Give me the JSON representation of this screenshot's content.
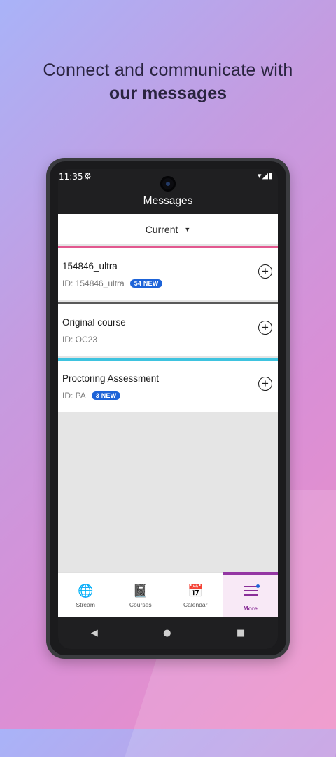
{
  "promo": {
    "line1": "Connect and communicate with",
    "line2": "our messages"
  },
  "status": {
    "time": "11:35",
    "gear_icon": "⚙",
    "icons": "▾◢▮"
  },
  "appbar": {
    "title": "Messages"
  },
  "filter": {
    "label": "Current",
    "caret": "▼"
  },
  "courses": [
    {
      "name": "154846_ultra",
      "id_text": "ID: 154846_ultra",
      "badge": "54 NEW",
      "color": "#e2588f"
    },
    {
      "name": "Original course",
      "id_text": "ID: OC23",
      "badge": "",
      "color": "#5a5a5a"
    },
    {
      "name": "Proctoring Assessment",
      "id_text": "ID: PA",
      "badge": "3 NEW",
      "color": "#3ec3df"
    }
  ],
  "tabs": [
    {
      "label": "Stream",
      "icon": "globe-icon",
      "glyph": "🌐"
    },
    {
      "label": "Courses",
      "icon": "book-icon",
      "glyph": "📓"
    },
    {
      "label": "Calendar",
      "icon": "calendar-icon",
      "glyph": "📅"
    },
    {
      "label": "More",
      "icon": "menu-icon",
      "glyph": ""
    }
  ],
  "nav": {
    "back": "◀",
    "home": "●",
    "recents": "■"
  },
  "colors": {
    "accent": "#9436a3",
    "badge": "#1d63d8"
  }
}
